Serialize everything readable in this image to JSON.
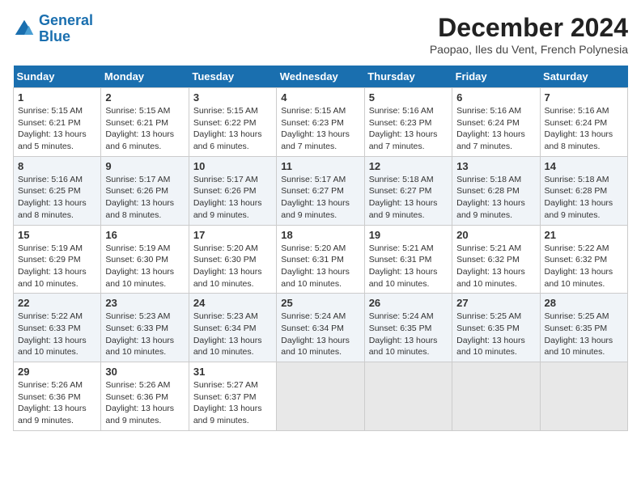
{
  "logo": {
    "line1": "General",
    "line2": "Blue"
  },
  "calendar": {
    "title": "December 2024",
    "subtitle": "Paopao, Iles du Vent, French Polynesia",
    "days_of_week": [
      "Sunday",
      "Monday",
      "Tuesday",
      "Wednesday",
      "Thursday",
      "Friday",
      "Saturday"
    ],
    "weeks": [
      [
        {
          "day": "1",
          "sunrise": "5:15 AM",
          "sunset": "6:21 PM",
          "daylight": "13 hours and 5 minutes."
        },
        {
          "day": "2",
          "sunrise": "5:15 AM",
          "sunset": "6:21 PM",
          "daylight": "13 hours and 6 minutes."
        },
        {
          "day": "3",
          "sunrise": "5:15 AM",
          "sunset": "6:22 PM",
          "daylight": "13 hours and 6 minutes."
        },
        {
          "day": "4",
          "sunrise": "5:15 AM",
          "sunset": "6:23 PM",
          "daylight": "13 hours and 7 minutes."
        },
        {
          "day": "5",
          "sunrise": "5:16 AM",
          "sunset": "6:23 PM",
          "daylight": "13 hours and 7 minutes."
        },
        {
          "day": "6",
          "sunrise": "5:16 AM",
          "sunset": "6:24 PM",
          "daylight": "13 hours and 7 minutes."
        },
        {
          "day": "7",
          "sunrise": "5:16 AM",
          "sunset": "6:24 PM",
          "daylight": "13 hours and 8 minutes."
        }
      ],
      [
        {
          "day": "8",
          "sunrise": "5:16 AM",
          "sunset": "6:25 PM",
          "daylight": "13 hours and 8 minutes."
        },
        {
          "day": "9",
          "sunrise": "5:17 AM",
          "sunset": "6:26 PM",
          "daylight": "13 hours and 8 minutes."
        },
        {
          "day": "10",
          "sunrise": "5:17 AM",
          "sunset": "6:26 PM",
          "daylight": "13 hours and 9 minutes."
        },
        {
          "day": "11",
          "sunrise": "5:17 AM",
          "sunset": "6:27 PM",
          "daylight": "13 hours and 9 minutes."
        },
        {
          "day": "12",
          "sunrise": "5:18 AM",
          "sunset": "6:27 PM",
          "daylight": "13 hours and 9 minutes."
        },
        {
          "day": "13",
          "sunrise": "5:18 AM",
          "sunset": "6:28 PM",
          "daylight": "13 hours and 9 minutes."
        },
        {
          "day": "14",
          "sunrise": "5:18 AM",
          "sunset": "6:28 PM",
          "daylight": "13 hours and 9 minutes."
        }
      ],
      [
        {
          "day": "15",
          "sunrise": "5:19 AM",
          "sunset": "6:29 PM",
          "daylight": "13 hours and 10 minutes."
        },
        {
          "day": "16",
          "sunrise": "5:19 AM",
          "sunset": "6:30 PM",
          "daylight": "13 hours and 10 minutes."
        },
        {
          "day": "17",
          "sunrise": "5:20 AM",
          "sunset": "6:30 PM",
          "daylight": "13 hours and 10 minutes."
        },
        {
          "day": "18",
          "sunrise": "5:20 AM",
          "sunset": "6:31 PM",
          "daylight": "13 hours and 10 minutes."
        },
        {
          "day": "19",
          "sunrise": "5:21 AM",
          "sunset": "6:31 PM",
          "daylight": "13 hours and 10 minutes."
        },
        {
          "day": "20",
          "sunrise": "5:21 AM",
          "sunset": "6:32 PM",
          "daylight": "13 hours and 10 minutes."
        },
        {
          "day": "21",
          "sunrise": "5:22 AM",
          "sunset": "6:32 PM",
          "daylight": "13 hours and 10 minutes."
        }
      ],
      [
        {
          "day": "22",
          "sunrise": "5:22 AM",
          "sunset": "6:33 PM",
          "daylight": "13 hours and 10 minutes."
        },
        {
          "day": "23",
          "sunrise": "5:23 AM",
          "sunset": "6:33 PM",
          "daylight": "13 hours and 10 minutes."
        },
        {
          "day": "24",
          "sunrise": "5:23 AM",
          "sunset": "6:34 PM",
          "daylight": "13 hours and 10 minutes."
        },
        {
          "day": "25",
          "sunrise": "5:24 AM",
          "sunset": "6:34 PM",
          "daylight": "13 hours and 10 minutes."
        },
        {
          "day": "26",
          "sunrise": "5:24 AM",
          "sunset": "6:35 PM",
          "daylight": "13 hours and 10 minutes."
        },
        {
          "day": "27",
          "sunrise": "5:25 AM",
          "sunset": "6:35 PM",
          "daylight": "13 hours and 10 minutes."
        },
        {
          "day": "28",
          "sunrise": "5:25 AM",
          "sunset": "6:35 PM",
          "daylight": "13 hours and 10 minutes."
        }
      ],
      [
        {
          "day": "29",
          "sunrise": "5:26 AM",
          "sunset": "6:36 PM",
          "daylight": "13 hours and 9 minutes."
        },
        {
          "day": "30",
          "sunrise": "5:26 AM",
          "sunset": "6:36 PM",
          "daylight": "13 hours and 9 minutes."
        },
        {
          "day": "31",
          "sunrise": "5:27 AM",
          "sunset": "6:37 PM",
          "daylight": "13 hours and 9 minutes."
        },
        null,
        null,
        null,
        null
      ]
    ]
  }
}
